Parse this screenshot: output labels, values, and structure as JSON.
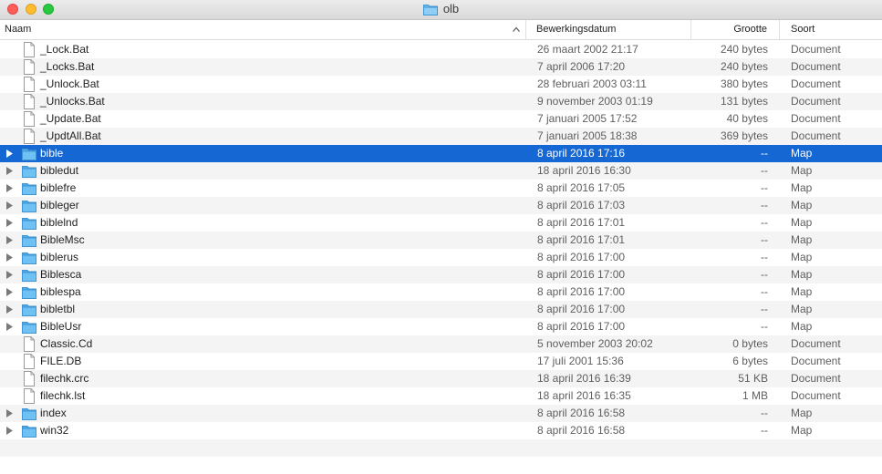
{
  "window": {
    "title": "olb",
    "title_icon": "folder-icon"
  },
  "columns": {
    "name": "Naam",
    "date": "Bewerkingsdatum",
    "size": "Grootte",
    "kind": "Soort",
    "sort_indicator": "chevron-up-icon"
  },
  "colors": {
    "selection": "#1567d3",
    "folder": "#5fb6ee",
    "alt_row": "#f4f4f5"
  },
  "rows": [
    {
      "name": "_Lock.Bat",
      "date": "26 maart 2002 21:17",
      "size": "240 bytes",
      "kind": "Document",
      "type": "file"
    },
    {
      "name": "_Locks.Bat",
      "date": "7 april 2006 17:20",
      "size": "240 bytes",
      "kind": "Document",
      "type": "file"
    },
    {
      "name": "_Unlock.Bat",
      "date": "28 februari 2003 03:11",
      "size": "380 bytes",
      "kind": "Document",
      "type": "file"
    },
    {
      "name": "_Unlocks.Bat",
      "date": "9 november 2003 01:19",
      "size": "131 bytes",
      "kind": "Document",
      "type": "file"
    },
    {
      "name": "_Update.Bat",
      "date": "7 januari 2005 17:52",
      "size": "40 bytes",
      "kind": "Document",
      "type": "file"
    },
    {
      "name": "_UpdtAll.Bat",
      "date": "7 januari 2005 18:38",
      "size": "369 bytes",
      "kind": "Document",
      "type": "file"
    },
    {
      "name": "bible",
      "date": "8 april 2016 17:16",
      "size": "--",
      "kind": "Map",
      "type": "folder",
      "selected": true
    },
    {
      "name": "bibledut",
      "date": "18 april 2016 16:30",
      "size": "--",
      "kind": "Map",
      "type": "folder"
    },
    {
      "name": "biblefre",
      "date": "8 april 2016 17:05",
      "size": "--",
      "kind": "Map",
      "type": "folder"
    },
    {
      "name": "bibleger",
      "date": "8 april 2016 17:03",
      "size": "--",
      "kind": "Map",
      "type": "folder"
    },
    {
      "name": "biblelnd",
      "date": "8 april 2016 17:01",
      "size": "--",
      "kind": "Map",
      "type": "folder"
    },
    {
      "name": "BibleMsc",
      "date": "8 april 2016 17:01",
      "size": "--",
      "kind": "Map",
      "type": "folder"
    },
    {
      "name": "biblerus",
      "date": "8 april 2016 17:00",
      "size": "--",
      "kind": "Map",
      "type": "folder"
    },
    {
      "name": "Biblesca",
      "date": "8 april 2016 17:00",
      "size": "--",
      "kind": "Map",
      "type": "folder"
    },
    {
      "name": "biblespa",
      "date": "8 april 2016 17:00",
      "size": "--",
      "kind": "Map",
      "type": "folder"
    },
    {
      "name": "bibletbl",
      "date": "8 april 2016 17:00",
      "size": "--",
      "kind": "Map",
      "type": "folder"
    },
    {
      "name": "BibleUsr",
      "date": "8 april 2016 17:00",
      "size": "--",
      "kind": "Map",
      "type": "folder"
    },
    {
      "name": "Classic.Cd",
      "date": "5 november 2003 20:02",
      "size": "0 bytes",
      "kind": "Document",
      "type": "file"
    },
    {
      "name": "FILE.DB",
      "date": "17 juli 2001 15:36",
      "size": "6 bytes",
      "kind": "Document",
      "type": "file"
    },
    {
      "name": "filechk.crc",
      "date": "18 april 2016 16:39",
      "size": "51 KB",
      "kind": "Document",
      "type": "file"
    },
    {
      "name": "filechk.lst",
      "date": "18 april 2016 16:35",
      "size": "1 MB",
      "kind": "Document",
      "type": "file"
    },
    {
      "name": "index",
      "date": "8 april 2016 16:58",
      "size": "--",
      "kind": "Map",
      "type": "folder"
    },
    {
      "name": "win32",
      "date": "8 april 2016 16:58",
      "size": "--",
      "kind": "Map",
      "type": "folder"
    }
  ]
}
